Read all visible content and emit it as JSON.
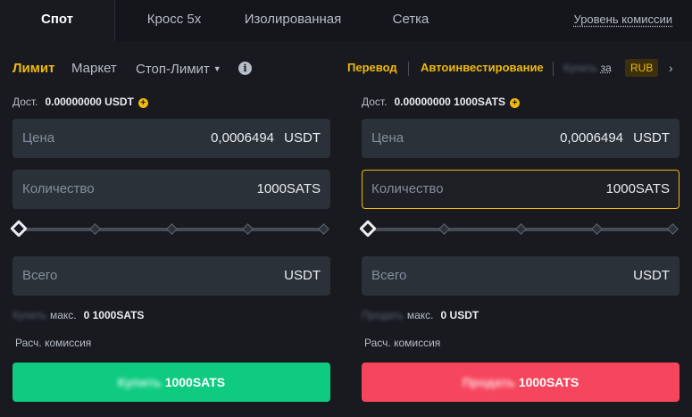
{
  "tabs": [
    "Спот",
    "Кросс 5x",
    "Изолированная",
    "Сетка"
  ],
  "fee_link": "Уровень комиссии",
  "order_types": {
    "limit": "Лимит",
    "market": "Маркет",
    "stop_limit": "Стоп-Лимит"
  },
  "top_actions": {
    "transfer": "Перевод",
    "auto_invest": "Автоинвестирование",
    "buy_blurred": "Купить",
    "za": "за",
    "currency": "RUB"
  },
  "buy": {
    "avail_label": "Дост.",
    "avail_value": "0.00000000 USDT",
    "price_label": "Цена",
    "price_value": "0,0006494",
    "price_unit": "USDT",
    "qty_label": "Количество",
    "qty_value": "1000SATS",
    "total_label": "Всего",
    "total_unit": "USDT",
    "max_blur": "Купить",
    "max_label": "макс.",
    "max_value": "0 1000SATS",
    "fee_label": "Расч. комиссия",
    "btn_blur": "Купить",
    "btn_label": "1000SATS"
  },
  "sell": {
    "avail_label": "Дост.",
    "avail_value": "0.00000000 1000SATS",
    "price_label": "Цена",
    "price_value": "0,0006494",
    "price_unit": "USDT",
    "qty_label": "Количество",
    "qty_value": "1000SATS",
    "total_label": "Всего",
    "total_unit": "USDT",
    "max_blur": "Продать",
    "max_label": "макс.",
    "max_value": "0 USDT",
    "fee_label": "Расч. комиссия",
    "btn_blur": "Продать",
    "btn_label": "1000SATS"
  },
  "colors": {
    "accent": "#f0b90b",
    "buy": "#0ecb81",
    "sell": "#f6465d",
    "bg": "#181a20",
    "field": "#2b3139"
  },
  "icons": [
    "info-icon",
    "plus-circle-icon",
    "chevron-right-icon",
    "caret-down-icon"
  ]
}
